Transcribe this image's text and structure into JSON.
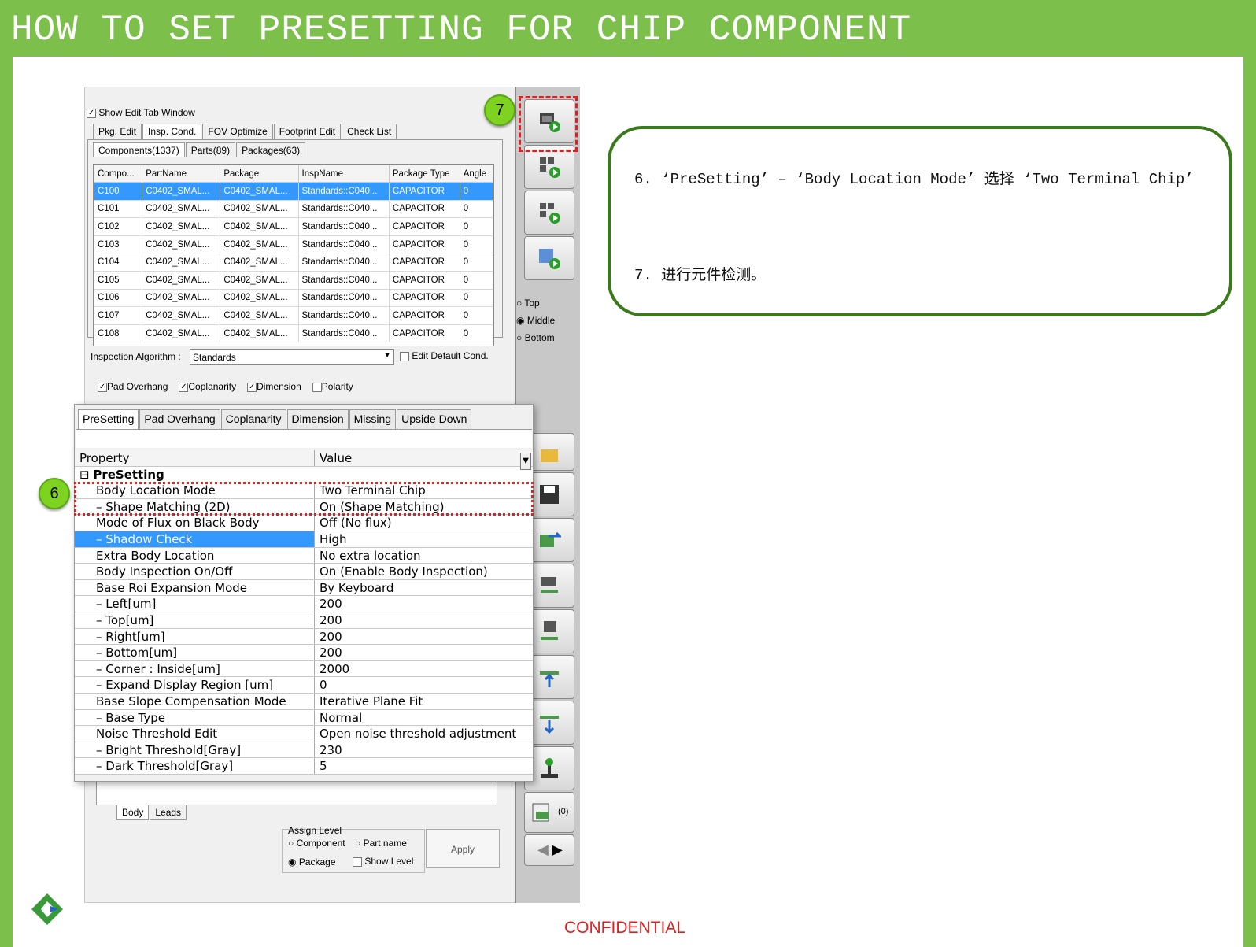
{
  "slide": {
    "title": "HOW TO SET PRESETTING FOR CHIP COMPONENT",
    "confidential": "CONFIDENTIAL",
    "marker_6": "6",
    "marker_7": "7",
    "note_line1": "6.  ‘PreSetting’ – ‘Body Location Mode’ 选择 ‘Two Terminal Chip’",
    "note_line2": "7. 进行元件检测。"
  },
  "window": {
    "show_edit_tab": "Show Edit Tab Window",
    "top_tabs": [
      "Pkg. Edit",
      "Insp. Cond.",
      "FOV Optimize",
      "Footprint Edit",
      "Check List"
    ],
    "sub_tabs": [
      "Components(1337)",
      "Parts(89)",
      "Packages(63)"
    ],
    "columns": [
      "Compo...",
      "PartName",
      "Package",
      "InspName",
      "Package Type",
      "Angle"
    ],
    "rows": [
      [
        "C100",
        "C0402_SMAL...",
        "C0402_SMAL...",
        "Standards::C040...",
        "CAPACITOR",
        "0"
      ],
      [
        "C101",
        "C0402_SMAL...",
        "C0402_SMAL...",
        "Standards::C040...",
        "CAPACITOR",
        "0"
      ],
      [
        "C102",
        "C0402_SMAL...",
        "C0402_SMAL...",
        "Standards::C040...",
        "CAPACITOR",
        "0"
      ],
      [
        "C103",
        "C0402_SMAL...",
        "C0402_SMAL...",
        "Standards::C040...",
        "CAPACITOR",
        "0"
      ],
      [
        "C104",
        "C0402_SMAL...",
        "C0402_SMAL...",
        "Standards::C040...",
        "CAPACITOR",
        "0"
      ],
      [
        "C105",
        "C0402_SMAL...",
        "C0402_SMAL...",
        "Standards::C040...",
        "CAPACITOR",
        "0"
      ],
      [
        "C106",
        "C0402_SMAL...",
        "C0402_SMAL...",
        "Standards::C040...",
        "CAPACITOR",
        "0"
      ],
      [
        "C107",
        "C0402_SMAL...",
        "C0402_SMAL...",
        "Standards::C040...",
        "CAPACITOR",
        "0"
      ],
      [
        "C108",
        "C0402_SMAL...",
        "C0402_SMAL...",
        "Standards::C040...",
        "CAPACITOR",
        "0"
      ]
    ],
    "insp_algo_label": "Inspection Algorithm :",
    "insp_algo_value": "Standards",
    "edit_default": "Edit Default Cond.",
    "checks": [
      "Pad Overhang",
      "Coplanarity",
      "Dimension",
      "Polarity"
    ],
    "bottom_tabs": [
      "Body",
      "Leads"
    ],
    "assign_level": "Assign Level",
    "assign_opts": [
      "Component",
      "Part name",
      "Package",
      "Show Level"
    ],
    "apply": "Apply",
    "side_radio": [
      "Top",
      "Middle",
      "Bottom"
    ],
    "side_count": "(0)"
  },
  "panel": {
    "tabs": [
      "PreSetting",
      "Pad Overhang",
      "Coplanarity",
      "Dimension",
      "Missing",
      "Upside Down"
    ],
    "col_property": "Property",
    "col_value": "Value",
    "group": "PreSetting",
    "rows": [
      {
        "k": "Body Location Mode",
        "v": "Two Terminal Chip"
      },
      {
        "k": "–     Shape Matching (2D)",
        "v": "On (Shape Matching)"
      },
      {
        "k": "Mode of Flux on Black Body",
        "v": "Off (No flux)"
      },
      {
        "k": "–     Shadow Check",
        "v": "High"
      },
      {
        "k": "Extra Body Location",
        "v": "No extra location"
      },
      {
        "k": "Body Inspection On/Off",
        "v": "On (Enable Body Inspection)"
      },
      {
        "k": "Base Roi Expansion Mode",
        "v": "By Keyboard"
      },
      {
        "k": "–     Left[um]",
        "v": "200"
      },
      {
        "k": "–     Top[um]",
        "v": "200"
      },
      {
        "k": "–     Right[um]",
        "v": "200"
      },
      {
        "k": "–     Bottom[um]",
        "v": "200"
      },
      {
        "k": "–     Corner : Inside[um]",
        "v": "2000"
      },
      {
        "k": "–     Expand Display Region [um]",
        "v": "0"
      },
      {
        "k": "Base Slope Compensation Mode",
        "v": "Iterative Plane Fit"
      },
      {
        "k": "–     Base Type",
        "v": "Normal"
      },
      {
        "k": "Noise Threshold Edit",
        "v": "Open noise threshold adjustment"
      },
      {
        "k": "–     Bright Threshold[Gray]",
        "v": "230"
      },
      {
        "k": "–     Dark Threshold[Gray]",
        "v": "5"
      }
    ]
  }
}
